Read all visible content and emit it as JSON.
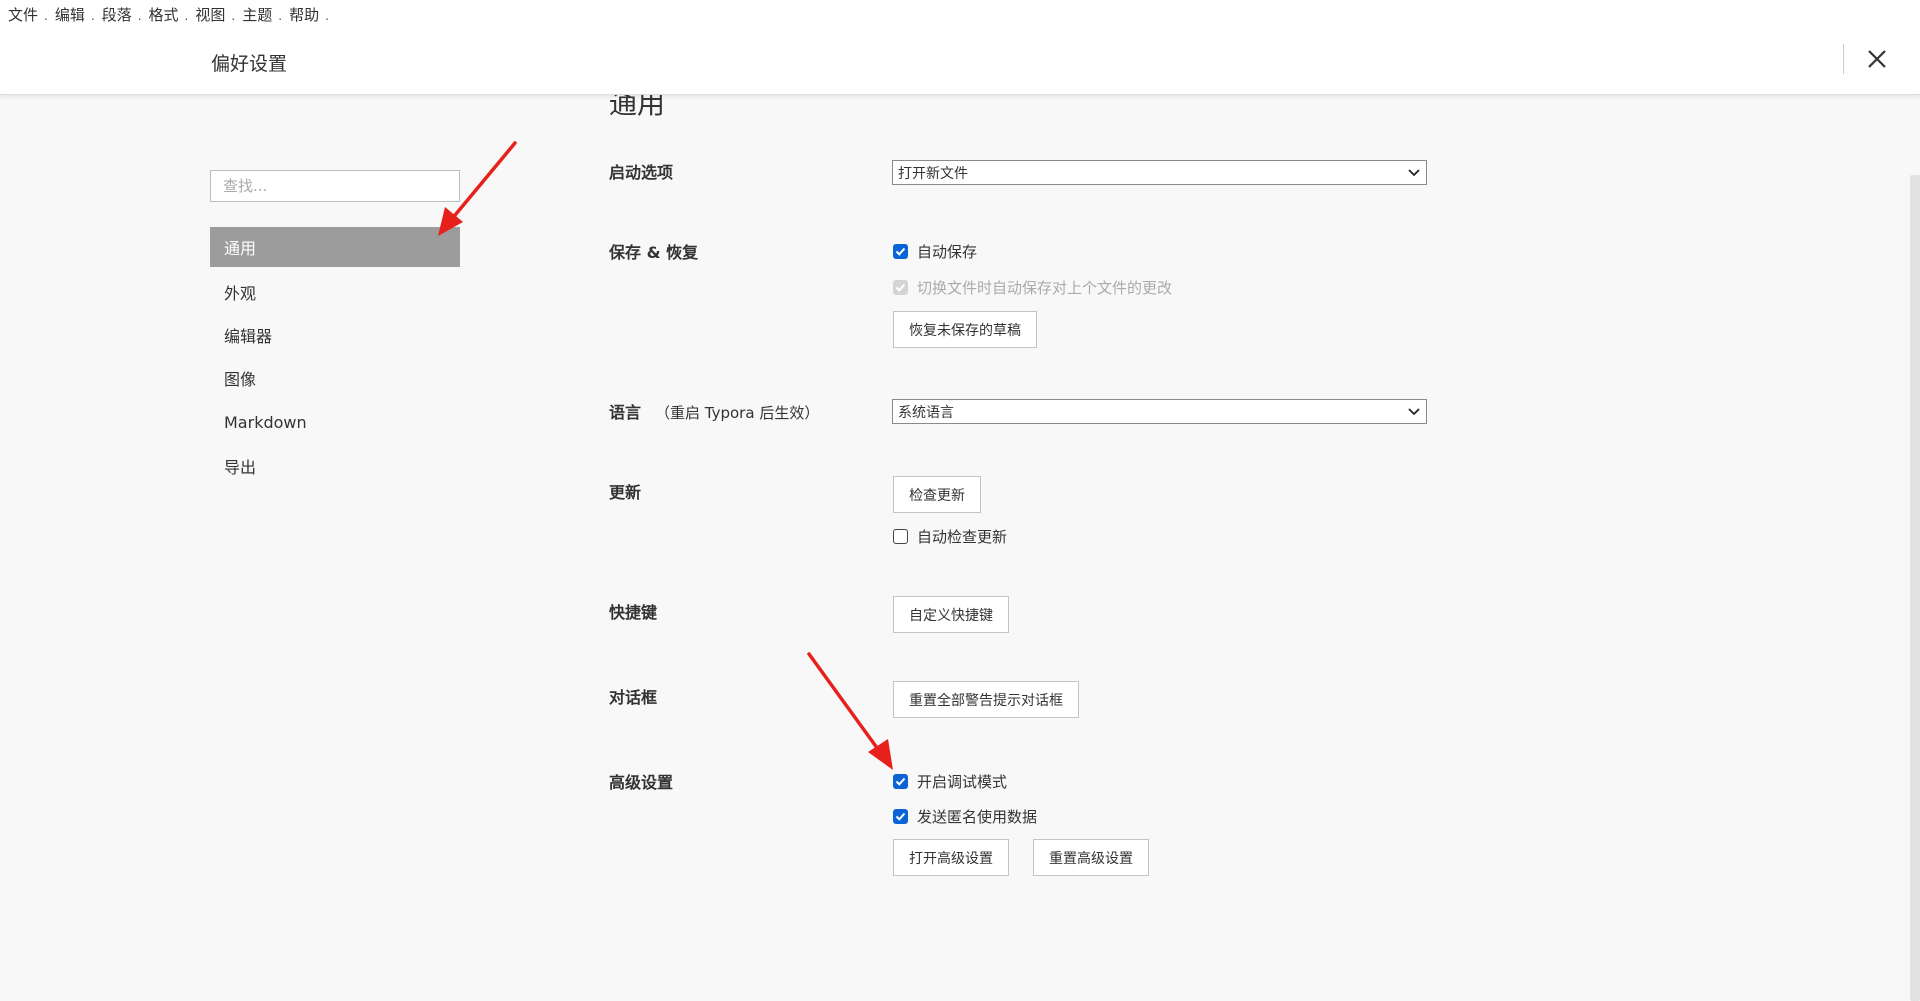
{
  "menubar": {
    "items": [
      {
        "label": "文件"
      },
      {
        "label": "编辑"
      },
      {
        "label": "段落"
      },
      {
        "label": "格式"
      },
      {
        "label": "视图"
      },
      {
        "label": "主题"
      },
      {
        "label": "帮助"
      }
    ],
    "separator": "."
  },
  "header": {
    "title": "偏好设置",
    "close_icon": "close-icon"
  },
  "sidebar": {
    "search_placeholder": "查找...",
    "items": [
      {
        "label": "通用",
        "active": true
      },
      {
        "label": "外观"
      },
      {
        "label": "编辑器"
      },
      {
        "label": "图像"
      },
      {
        "label": "Markdown"
      },
      {
        "label": "导出"
      }
    ]
  },
  "main": {
    "section_title": "通用",
    "startup": {
      "label": "启动选项",
      "select_value": "打开新文件"
    },
    "save_restore": {
      "label": "保存 & 恢复",
      "autosave_label": "自动保存",
      "autosave_checked": true,
      "autosave_switch_label": "切换文件时自动保存对上个文件的更改",
      "autosave_switch_checked": true,
      "recover_button": "恢复未保存的草稿"
    },
    "language": {
      "label": "语言",
      "note": "（重启 Typora 后生效）",
      "select_value": "系统语言"
    },
    "update": {
      "label": "更新",
      "check_button": "检查更新",
      "auto_check_label": "自动检查更新",
      "auto_check_checked": false
    },
    "shortcuts": {
      "label": "快捷键",
      "customize_button": "自定义快捷键"
    },
    "dialogs": {
      "label": "对话框",
      "reset_button": "重置全部警告提示对话框"
    },
    "advanced": {
      "label": "高级设置",
      "debug_label": "开启调试模式",
      "debug_checked": true,
      "telemetry_label": "发送匿名使用数据",
      "telemetry_checked": true,
      "open_button": "打开高级设置",
      "reset_button": "重置高级设置"
    }
  },
  "colors": {
    "accent": "#0a64d6",
    "active_nav": "#9c9c9c",
    "annotation_arrow": "#e8201c"
  }
}
